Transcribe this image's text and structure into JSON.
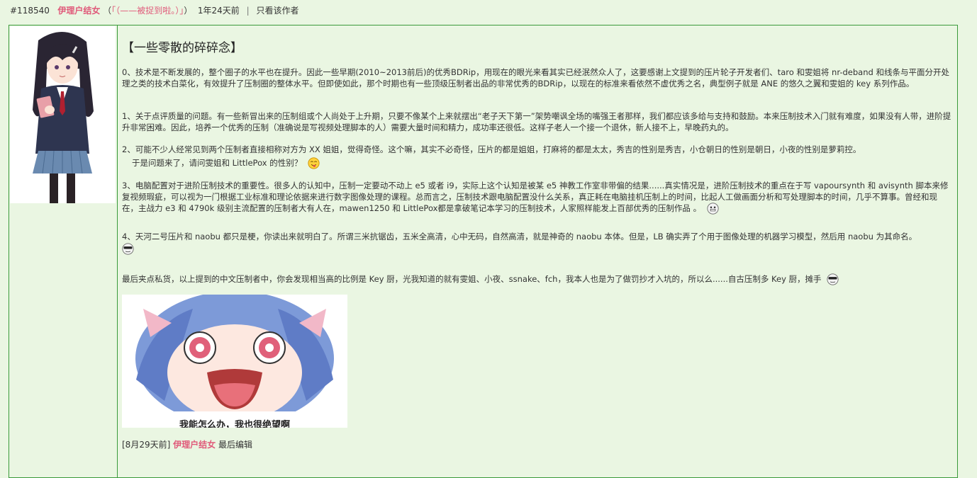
{
  "meta": {
    "post_id": "#118540",
    "author": "伊理户结女",
    "nickname_open": "（",
    "nickname": "「（——被捉到啦。）」",
    "nickname_close": "）",
    "time": "1年24天前",
    "separator": "|",
    "only_author": "只看该作者"
  },
  "post": {
    "title": "【一些零散的碎碎念】",
    "paragraphs": [
      "0、技术是不断发展的，整个圈子的水平也在提升。因此一些早期(2010~2013前后)的优秀BDRip，用现在的眼光来看其实已经泯然众人了，这要感谢上文提到的压片轮子开发者们、taro 和雯姐将 nr-deband 和线条与平面分开处理之类的技术白菜化，有效提升了压制圈的整体水平。但即使如此，那个时期也有一些顶级压制者出品的非常优秀的BDRip，以现在的标准来看依然不虚优秀之名，典型例子就是 ANE 的悠久之翼和雯姐的 key 系列作品。",
      "1、关于点评质量的问题。有一些新冒出来的压制组或个人尚处于上升期，只要不像某个上来就摆出“老子天下第一”架势嘲讽全场的嘴强王者那样，我们都应该多给与支持和鼓励。本来压制技术入门就有难度，如果没有人带，进阶提升非常困难。因此，培养一个优秀的压制（准确说是写视频处理脚本的人）需要大量时间和精力，成功率还很低。这样子老人一个接一个退休，新人接不上，早晚药丸的。",
      "2、可能不少人经常见到两个压制者直接相称对方为 XX 姐姐，觉得奇怪。这个嘛，其实不必奇怪，压片的都是姐姐，打麻将的都是太太，秀吉的性别是秀吉，小仓朝日的性别是朝日，小夜的性别是萝莉控。",
      "于是问题来了，请问雯姐和 LittlePox 的性别？",
      "3、电脑配置对于进阶压制技术的重要性。很多人的认知中，压制一定要动不动上 e5 或者 i9，实际上这个认知是被某 e5 神教工作室非带偏的结果......真实情况是，进阶压制技术的重点在于写 vapoursynth 和 avisynth 脚本来修复视频瑕疵，可以视为一门根据工业标准和理论依据来进行数字图像处理的课程。总而言之，压制技术跟电脑配置没什么关系，真正耗在电脑挂机压制上的时间，比起人工做画面分析和写处理脚本的时间，几乎不算事。曾经和现在，主战力 e3 和 4790k 级别主流配置的压制者大有人在，mawen1250 和 LittlePox都是拿破笔记本学习的压制技术，人家照样能发上百部优秀的压制作品 。",
      "4、天河二号压片和 naobu 都只是梗，你读出来就明白了。所谓三米抗锯齿，五米全高清，心中无码，自然高清，就是神奇的 naobu 本体。但是，LB 确实弄了个用于图像处理的机器学习模型，然后用 naobu 为其命名。",
      "最后夹点私货，以上提到的中文压制者中，你会发现相当高的比例是 Key 厨，光我知道的就有雯姐、小夜、ssnake、fch，我本人也是为了做罚抄才入坑的，所以么......自古压制多 Key 厨，摊手"
    ],
    "image_caption": "我能怎么办，我也很绝望啊",
    "footer_time": "[8月29天前]",
    "footer_author": "伊理户结女",
    "footer_suffix": "最后编辑"
  },
  "colors": {
    "background": "#eaf6e2",
    "border": "#3a9a3a",
    "author_pink": "#e05a7a"
  },
  "icons": [
    "tongue-emoji-icon",
    "grin-emoji-icon",
    "sunglasses-emoji-icon"
  ]
}
